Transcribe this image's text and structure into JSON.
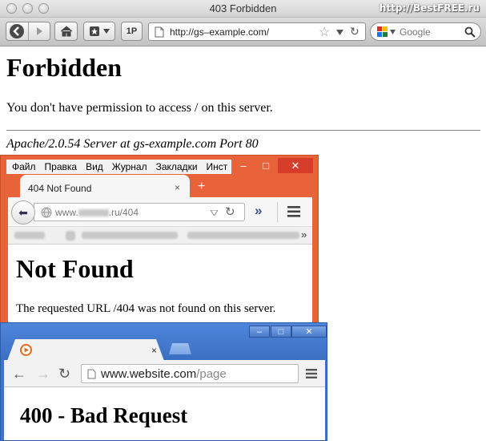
{
  "watermark": "http://BestFREE.ru",
  "mac": {
    "title": "403 Forbidden",
    "toolbar": {
      "page_button_label": "1P"
    },
    "url": "http://gs–example.com/",
    "search": {
      "placeholder": "Google"
    },
    "content": {
      "heading": "Forbidden",
      "message": "You don't have permission to access / on this server.",
      "address": "Apache/2.0.54 Server at gs-example.com Port 80"
    }
  },
  "firefox": {
    "menu": [
      "Файл",
      "Правка",
      "Вид",
      "Журнал",
      "Закладки",
      "Инст"
    ],
    "tab": {
      "title": "404 Not Found",
      "close": "×",
      "new_tab": "+"
    },
    "url": {
      "host": "www.",
      "path": ".ru/404"
    },
    "window_controls": {
      "minimize": "–",
      "maximize": "□",
      "close": "✕"
    },
    "overflow": "»",
    "content": {
      "heading": "Not Found",
      "message": "The requested URL /404 was not found on this server."
    }
  },
  "chrome": {
    "tab": {
      "close": "×"
    },
    "window_controls": {
      "minimize": "–",
      "maximize": "□",
      "close": "✕"
    },
    "url": {
      "host": "www.website.com",
      "path": "/page"
    },
    "content": {
      "heading": "400 - Bad Request"
    }
  },
  "colors": {
    "firefox_frame": "#e9633a",
    "chrome_frame": "#3e74c9"
  }
}
